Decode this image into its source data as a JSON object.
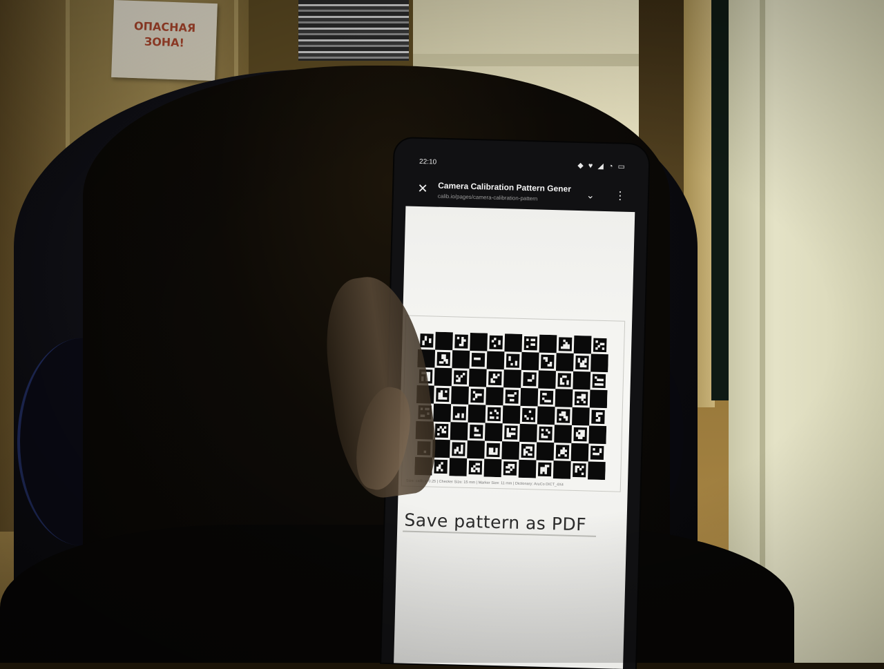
{
  "scene": {
    "poster_line1": "ОПАСНАЯ",
    "poster_line2": "ЗОНА!"
  },
  "phone": {
    "status": {
      "time": "22:10",
      "icons": "◆ ♥ ◢ ◔ ▭"
    },
    "browser": {
      "title": "Camera Calibration Pattern Gener",
      "url": "calib.io/pages/camera-calibration-pattern",
      "close_icon": "close-icon",
      "chevron_icon": "chevron-down-icon",
      "menu_icon": "more-vertical-icon"
    },
    "page": {
      "pattern": {
        "type": "charuco-board",
        "rows": 8,
        "cols": 11,
        "caption": "Size: calib.io 0.25 | Checker Size: 15 mm | Marker Size: 11 mm | Dictionary: AruCo DICT_4X4"
      },
      "save_button": "Save pattern as PDF"
    }
  }
}
